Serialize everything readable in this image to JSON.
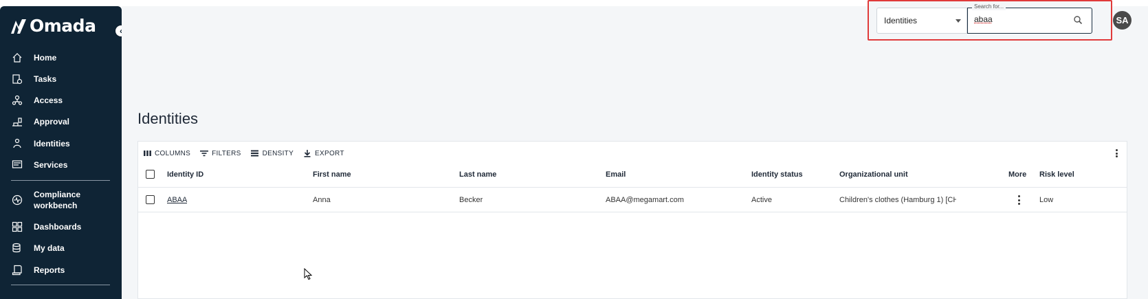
{
  "app": {
    "name": "Omada"
  },
  "sidebar": {
    "items": [
      {
        "label": "Home",
        "icon": "home-icon"
      },
      {
        "label": "Tasks",
        "icon": "tasks-icon"
      },
      {
        "label": "Access",
        "icon": "access-icon"
      },
      {
        "label": "Approval",
        "icon": "approval-icon"
      },
      {
        "label": "Identities",
        "icon": "identities-icon"
      },
      {
        "label": "Services",
        "icon": "services-icon"
      },
      {
        "label": "Compliance workbench",
        "icon": "compliance-icon"
      },
      {
        "label": "Dashboards",
        "icon": "dashboards-icon"
      },
      {
        "label": "My data",
        "icon": "my-data-icon"
      },
      {
        "label": "Reports",
        "icon": "reports-icon"
      }
    ]
  },
  "header": {
    "scope_select": {
      "value": "Identities"
    },
    "search": {
      "label": "Search for...",
      "value": "abaa"
    },
    "avatar_initials": "SA"
  },
  "page": {
    "title": "Identities"
  },
  "grid": {
    "toolbar": {
      "columns": "COLUMNS",
      "filters": "FILTERS",
      "density": "DENSITY",
      "export": "EXPORT"
    },
    "columns": [
      "Identity ID",
      "First name",
      "Last name",
      "Email",
      "Identity status",
      "Organizational unit",
      "More",
      "Risk level"
    ],
    "rows": [
      {
        "identity_id": "ABAA",
        "first_name": "Anna",
        "last_name": "Becker",
        "email": "ABAA@megamart.com",
        "status": "Active",
        "org_unit": "Children's clothes (Hamburg 1) [CHI...",
        "risk": "Low"
      }
    ]
  },
  "colors": {
    "sidebar": "#0f2435",
    "highlight": "#e03a3a",
    "background": "#f4f6f8"
  }
}
